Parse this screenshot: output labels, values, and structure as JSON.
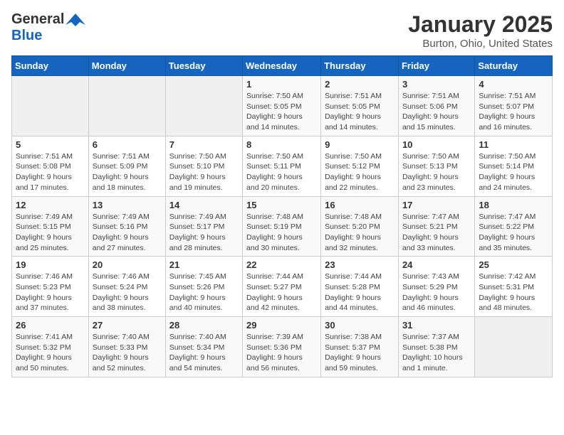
{
  "header": {
    "logo_general": "General",
    "logo_blue": "Blue",
    "title": "January 2025",
    "subtitle": "Burton, Ohio, United States"
  },
  "days_of_week": [
    "Sunday",
    "Monday",
    "Tuesday",
    "Wednesday",
    "Thursday",
    "Friday",
    "Saturday"
  ],
  "weeks": [
    [
      {
        "num": "",
        "info": ""
      },
      {
        "num": "",
        "info": ""
      },
      {
        "num": "",
        "info": ""
      },
      {
        "num": "1",
        "info": "Sunrise: 7:50 AM\nSunset: 5:05 PM\nDaylight: 9 hours\nand 14 minutes."
      },
      {
        "num": "2",
        "info": "Sunrise: 7:51 AM\nSunset: 5:05 PM\nDaylight: 9 hours\nand 14 minutes."
      },
      {
        "num": "3",
        "info": "Sunrise: 7:51 AM\nSunset: 5:06 PM\nDaylight: 9 hours\nand 15 minutes."
      },
      {
        "num": "4",
        "info": "Sunrise: 7:51 AM\nSunset: 5:07 PM\nDaylight: 9 hours\nand 16 minutes."
      }
    ],
    [
      {
        "num": "5",
        "info": "Sunrise: 7:51 AM\nSunset: 5:08 PM\nDaylight: 9 hours\nand 17 minutes."
      },
      {
        "num": "6",
        "info": "Sunrise: 7:51 AM\nSunset: 5:09 PM\nDaylight: 9 hours\nand 18 minutes."
      },
      {
        "num": "7",
        "info": "Sunrise: 7:50 AM\nSunset: 5:10 PM\nDaylight: 9 hours\nand 19 minutes."
      },
      {
        "num": "8",
        "info": "Sunrise: 7:50 AM\nSunset: 5:11 PM\nDaylight: 9 hours\nand 20 minutes."
      },
      {
        "num": "9",
        "info": "Sunrise: 7:50 AM\nSunset: 5:12 PM\nDaylight: 9 hours\nand 22 minutes."
      },
      {
        "num": "10",
        "info": "Sunrise: 7:50 AM\nSunset: 5:13 PM\nDaylight: 9 hours\nand 23 minutes."
      },
      {
        "num": "11",
        "info": "Sunrise: 7:50 AM\nSunset: 5:14 PM\nDaylight: 9 hours\nand 24 minutes."
      }
    ],
    [
      {
        "num": "12",
        "info": "Sunrise: 7:49 AM\nSunset: 5:15 PM\nDaylight: 9 hours\nand 25 minutes."
      },
      {
        "num": "13",
        "info": "Sunrise: 7:49 AM\nSunset: 5:16 PM\nDaylight: 9 hours\nand 27 minutes."
      },
      {
        "num": "14",
        "info": "Sunrise: 7:49 AM\nSunset: 5:17 PM\nDaylight: 9 hours\nand 28 minutes."
      },
      {
        "num": "15",
        "info": "Sunrise: 7:48 AM\nSunset: 5:19 PM\nDaylight: 9 hours\nand 30 minutes."
      },
      {
        "num": "16",
        "info": "Sunrise: 7:48 AM\nSunset: 5:20 PM\nDaylight: 9 hours\nand 32 minutes."
      },
      {
        "num": "17",
        "info": "Sunrise: 7:47 AM\nSunset: 5:21 PM\nDaylight: 9 hours\nand 33 minutes."
      },
      {
        "num": "18",
        "info": "Sunrise: 7:47 AM\nSunset: 5:22 PM\nDaylight: 9 hours\nand 35 minutes."
      }
    ],
    [
      {
        "num": "19",
        "info": "Sunrise: 7:46 AM\nSunset: 5:23 PM\nDaylight: 9 hours\nand 37 minutes."
      },
      {
        "num": "20",
        "info": "Sunrise: 7:46 AM\nSunset: 5:24 PM\nDaylight: 9 hours\nand 38 minutes."
      },
      {
        "num": "21",
        "info": "Sunrise: 7:45 AM\nSunset: 5:26 PM\nDaylight: 9 hours\nand 40 minutes."
      },
      {
        "num": "22",
        "info": "Sunrise: 7:44 AM\nSunset: 5:27 PM\nDaylight: 9 hours\nand 42 minutes."
      },
      {
        "num": "23",
        "info": "Sunrise: 7:44 AM\nSunset: 5:28 PM\nDaylight: 9 hours\nand 44 minutes."
      },
      {
        "num": "24",
        "info": "Sunrise: 7:43 AM\nSunset: 5:29 PM\nDaylight: 9 hours\nand 46 minutes."
      },
      {
        "num": "25",
        "info": "Sunrise: 7:42 AM\nSunset: 5:31 PM\nDaylight: 9 hours\nand 48 minutes."
      }
    ],
    [
      {
        "num": "26",
        "info": "Sunrise: 7:41 AM\nSunset: 5:32 PM\nDaylight: 9 hours\nand 50 minutes."
      },
      {
        "num": "27",
        "info": "Sunrise: 7:40 AM\nSunset: 5:33 PM\nDaylight: 9 hours\nand 52 minutes."
      },
      {
        "num": "28",
        "info": "Sunrise: 7:40 AM\nSunset: 5:34 PM\nDaylight: 9 hours\nand 54 minutes."
      },
      {
        "num": "29",
        "info": "Sunrise: 7:39 AM\nSunset: 5:36 PM\nDaylight: 9 hours\nand 56 minutes."
      },
      {
        "num": "30",
        "info": "Sunrise: 7:38 AM\nSunset: 5:37 PM\nDaylight: 9 hours\nand 59 minutes."
      },
      {
        "num": "31",
        "info": "Sunrise: 7:37 AM\nSunset: 5:38 PM\nDaylight: 10 hours\nand 1 minute."
      },
      {
        "num": "",
        "info": ""
      }
    ]
  ]
}
